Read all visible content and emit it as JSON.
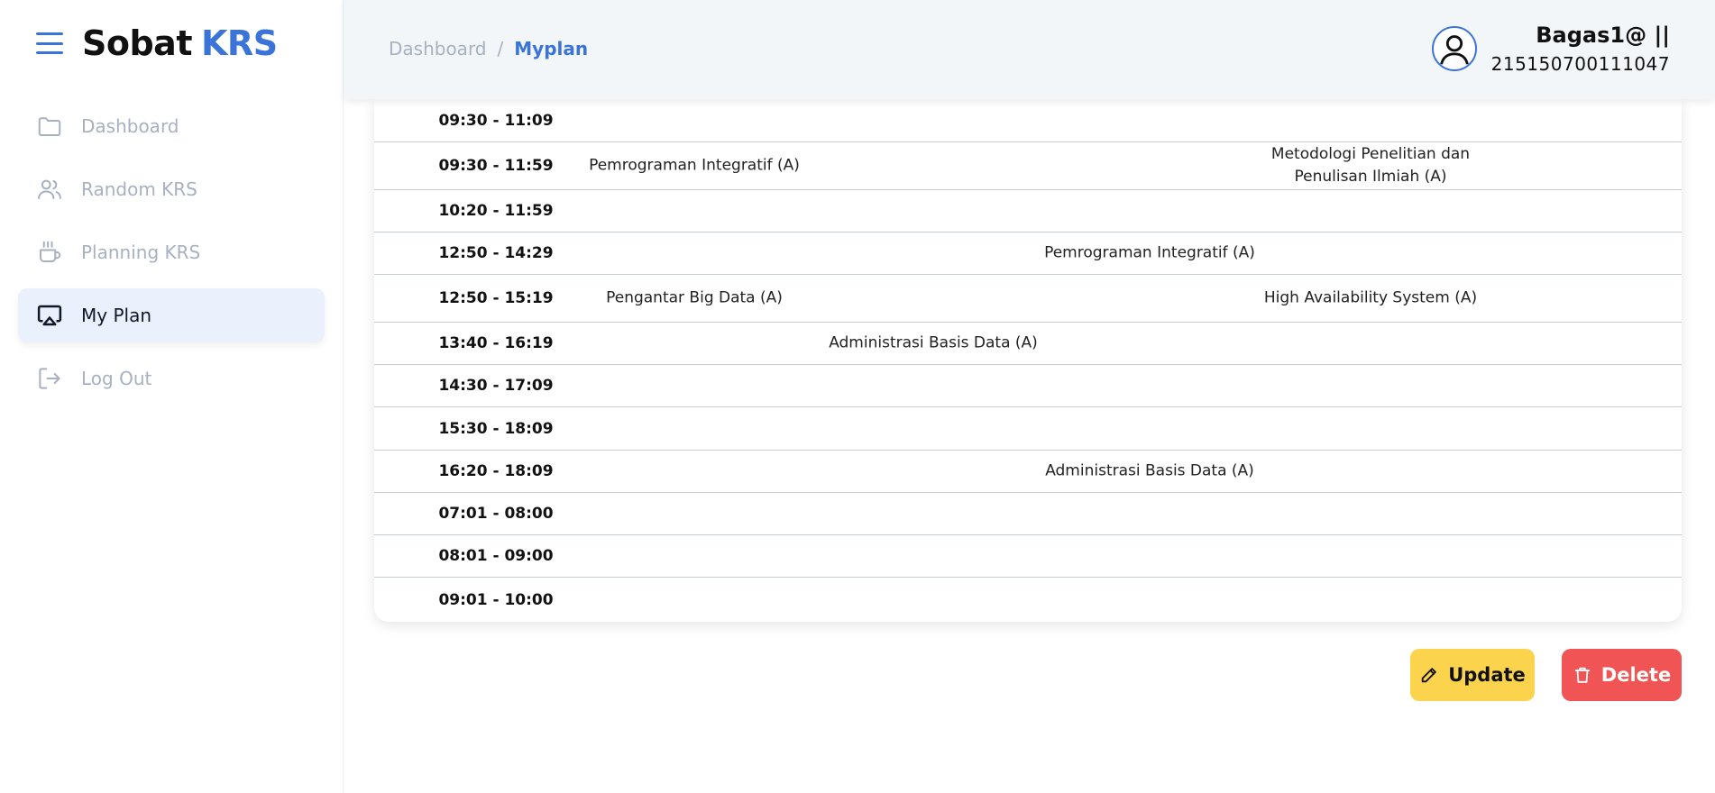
{
  "brand": {
    "name_part1": "Sobat",
    "name_part2": "KRS"
  },
  "sidebar": {
    "items": [
      {
        "label": "Dashboard",
        "icon": "folder-icon"
      },
      {
        "label": "Random KRS",
        "icon": "users-icon"
      },
      {
        "label": "Planning KRS",
        "icon": "cup-icon"
      },
      {
        "label": "My Plan",
        "icon": "airplay-icon",
        "active": true
      },
      {
        "label": "Log Out",
        "icon": "logout-icon"
      }
    ]
  },
  "header": {
    "breadcrumb": [
      "Dashboard",
      "Myplan"
    ],
    "separator": "/",
    "user_name": "Bagas1@ ||",
    "user_nim": "215150700111047"
  },
  "schedule": {
    "rows": [
      {
        "time": "09:30 - 11:09",
        "c1": "",
        "c2": "",
        "c3": "",
        "c4": ""
      },
      {
        "time": "09:30 - 11:59",
        "c1": "Pemrograman Integratif (A)",
        "c2": "",
        "c3": "",
        "c4": "Metodologi Penelitian dan Penulisan Ilmiah (A)"
      },
      {
        "time": "10:20 - 11:59",
        "c1": "",
        "c2": "",
        "c3": "",
        "c4": ""
      },
      {
        "time": "12:50 - 14:29",
        "c1": "",
        "c2": "",
        "c3": "Pemrograman Integratif (A)",
        "c4": ""
      },
      {
        "time": "12:50 - 15:19",
        "c1": "Pengantar Big Data (A)",
        "c2": "",
        "c3": "",
        "c4": "High Availability System (A)"
      },
      {
        "time": "13:40 - 16:19",
        "c1": "",
        "c2": "Administrasi Basis Data (A)",
        "c3": "",
        "c4": ""
      },
      {
        "time": "14:30 - 17:09",
        "c1": "",
        "c2": "",
        "c3": "",
        "c4": ""
      },
      {
        "time": "15:30 - 18:09",
        "c1": "",
        "c2": "",
        "c3": "",
        "c4": ""
      },
      {
        "time": "16:20 - 18:09",
        "c1": "",
        "c2": "",
        "c3": "Administrasi Basis Data (A)",
        "c4": ""
      },
      {
        "time": "07:01 - 08:00",
        "c1": "",
        "c2": "",
        "c3": "",
        "c4": ""
      },
      {
        "time": "08:01 - 09:00",
        "c1": "",
        "c2": "",
        "c3": "",
        "c4": ""
      },
      {
        "time": "09:01 - 10:00",
        "c1": "",
        "c2": "",
        "c3": "",
        "c4": ""
      }
    ]
  },
  "actions": {
    "update_label": "Update",
    "delete_label": "Delete"
  },
  "colors": {
    "accent": "#3b74d8",
    "update": "#fcd34d",
    "delete": "#f05454"
  }
}
